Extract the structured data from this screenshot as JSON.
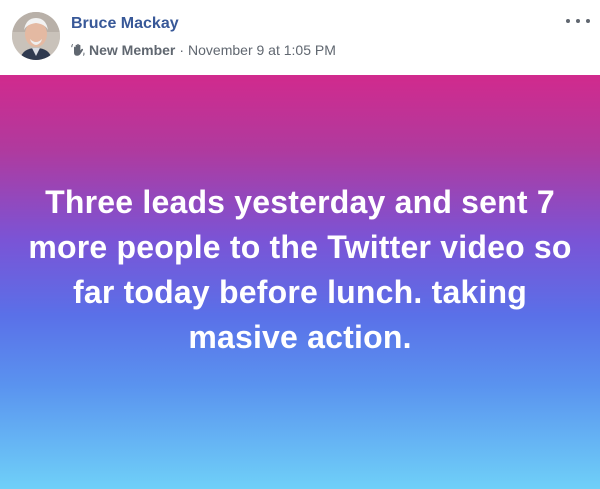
{
  "post": {
    "author": {
      "name": "Bruce Mackay",
      "avatar_icon": "profile-photo"
    },
    "meta": {
      "badge_icon": "waving-hand-icon",
      "badge_label": "New Member",
      "separator": "·",
      "timestamp": "November 9 at 1:05 PM"
    },
    "more_icon": "more-horizontal-icon",
    "status_text": "Three leads yesterday and sent 7 more people to the Twitter video so far today before lunch. taking masive action.",
    "colors": {
      "name_link": "#385898",
      "meta_text": "#606770",
      "gradient_top": "#d12a8d",
      "gradient_mid": "#5a70e8",
      "gradient_bottom": "#6fd0f8",
      "status_text": "#ffffff"
    }
  }
}
